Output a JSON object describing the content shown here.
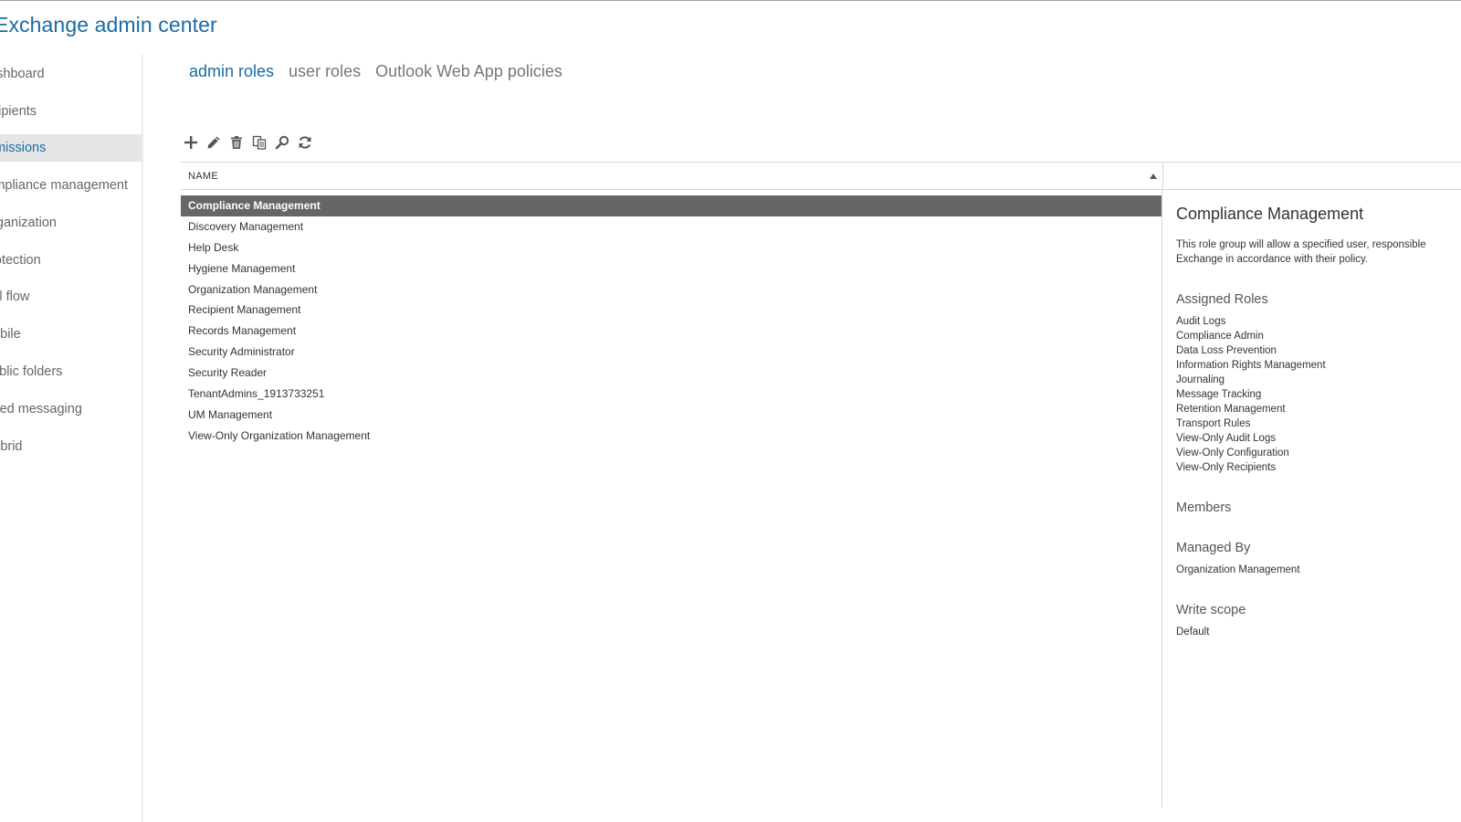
{
  "app": {
    "title": "Exchange admin center"
  },
  "sidebar": {
    "items": [
      {
        "label": "dashboard",
        "active": false
      },
      {
        "label": "recipients",
        "active": false
      },
      {
        "label": "permissions",
        "active": true
      },
      {
        "label": "compliance management",
        "active": false
      },
      {
        "label": "organization",
        "active": false
      },
      {
        "label": "protection",
        "active": false
      },
      {
        "label": "mail flow",
        "active": false
      },
      {
        "label": "mobile",
        "active": false
      },
      {
        "label": "public folders",
        "active": false
      },
      {
        "label": "unified messaging",
        "active": false
      },
      {
        "label": "hybrid",
        "active": false
      }
    ]
  },
  "tabs": [
    {
      "label": "admin roles",
      "active": true
    },
    {
      "label": "user roles",
      "active": false
    },
    {
      "label": "Outlook Web App policies",
      "active": false
    }
  ],
  "toolbar": {
    "buttons": [
      {
        "name": "add-icon"
      },
      {
        "name": "edit-icon"
      },
      {
        "name": "delete-icon"
      },
      {
        "name": "copy-icon"
      },
      {
        "name": "search-icon"
      },
      {
        "name": "refresh-icon"
      }
    ]
  },
  "list": {
    "column_header": "NAME",
    "sort": "ascending",
    "items": [
      {
        "label": "Compliance Management",
        "selected": true
      },
      {
        "label": "Discovery Management",
        "selected": false
      },
      {
        "label": "Help Desk",
        "selected": false
      },
      {
        "label": "Hygiene Management",
        "selected": false
      },
      {
        "label": "Organization Management",
        "selected": false
      },
      {
        "label": "Recipient Management",
        "selected": false
      },
      {
        "label": "Records Management",
        "selected": false
      },
      {
        "label": "Security Administrator",
        "selected": false
      },
      {
        "label": "Security Reader",
        "selected": false
      },
      {
        "label": "TenantAdmins_1913733251",
        "selected": false
      },
      {
        "label": "UM Management",
        "selected": false
      },
      {
        "label": "View-Only Organization Management",
        "selected": false
      }
    ]
  },
  "detail": {
    "title": "Compliance Management",
    "description_line1": "This role group will allow a specified user, responsible",
    "description_line2": "Exchange in accordance with their policy.",
    "assigned_roles_heading": "Assigned Roles",
    "assigned_roles": [
      "Audit Logs",
      "Compliance Admin",
      "Data Loss Prevention",
      "Information Rights Management",
      "Journaling",
      "Message Tracking",
      "Retention Management",
      "Transport Rules",
      "View-Only Audit Logs",
      "View-Only Configuration",
      "View-Only Recipients"
    ],
    "members_heading": "Members",
    "managed_by_heading": "Managed By",
    "managed_by": "Organization Management",
    "write_scope_heading": "Write scope",
    "write_scope": "Default"
  },
  "colors": {
    "accent": "#1a6aa4",
    "selected_row": "#666666",
    "active_nav_bg": "#e6e6e6"
  }
}
